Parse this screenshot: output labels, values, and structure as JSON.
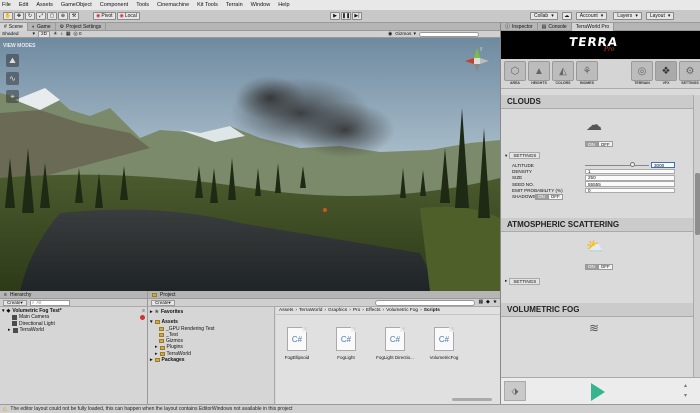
{
  "menu": [
    "File",
    "Edit",
    "Assets",
    "GameObject",
    "Component",
    "Tools",
    "Cinemachine",
    "Kit Tools",
    "Terrain",
    "Window",
    "Help"
  ],
  "toolbar": {
    "pivot": "Pivot",
    "local": "Local",
    "collab": "Collab",
    "account": "Account",
    "layers": "Layers",
    "layout": "Layout"
  },
  "scene_tabs": [
    "Scene",
    "Game",
    "Project Settings"
  ],
  "scene_bar": {
    "shaded": "Shaded",
    "mode_2d": "2D",
    "gizmos": "Gizmos"
  },
  "viewport": {
    "view_modes": "VIEW MODES",
    "gizmo_axis": "y"
  },
  "hierarchy": {
    "tab": "Hierarchy",
    "create": "Create",
    "search": "All",
    "items": [
      {
        "label": "Volumetric Fog Test*",
        "level": 0,
        "bold": true
      },
      {
        "label": "Main Camera",
        "level": 1
      },
      {
        "label": "Directional Light",
        "level": 1
      },
      {
        "label": "TerraWorld",
        "level": 1
      }
    ]
  },
  "project": {
    "tab": "Project",
    "create": "Create",
    "favorites": "Favorites",
    "tree": [
      {
        "label": "Assets",
        "level": 0,
        "bold": true
      },
      {
        "label": "_GPU Rendering Test",
        "level": 1
      },
      {
        "label": "_Test",
        "level": 1
      },
      {
        "label": "Gizmos",
        "level": 1
      },
      {
        "label": "Plugins",
        "level": 1
      },
      {
        "label": "TerraWorld",
        "level": 1
      },
      {
        "label": "Packages",
        "level": 0,
        "bold": true
      }
    ],
    "breadcrumb": [
      "Assets",
      "TerraWorld",
      "Graphics",
      "Pro",
      "Effects",
      "Volumetric Fog",
      "Scripts"
    ],
    "files": [
      {
        "name": "FogEllipsoid",
        "glyph": "C#"
      },
      {
        "name": "FogLight",
        "glyph": "C#"
      },
      {
        "name": "FogLight Directio...",
        "glyph": "C#"
      },
      {
        "name": "VolumetricFog",
        "glyph": "C#"
      }
    ]
  },
  "inspector": {
    "tabs": [
      "Inspector",
      "Console",
      "TerraWorld Pro"
    ],
    "logo_main": "TERRA",
    "logo_sub": "Pro",
    "icons_left": [
      {
        "icon": "area-icon",
        "label": "AREA"
      },
      {
        "icon": "heights-icon",
        "label": "HEIGHTS"
      },
      {
        "icon": "colors-icon",
        "label": "COLORS"
      },
      {
        "icon": "biomes-icon",
        "label": "BIOMES"
      }
    ],
    "icons_right": [
      {
        "icon": "terrain-icon",
        "label": "TERRAIN"
      },
      {
        "icon": "vfx-icon",
        "label": "VFX",
        "selected": true
      },
      {
        "icon": "settings-icon",
        "label": "SETTINGS"
      }
    ],
    "clouds": {
      "title": "CLOUDS",
      "on": "ON",
      "off": "OFF",
      "settings": "SETTINGS",
      "rows": [
        {
          "key": "ALTITUDE",
          "value": "3000",
          "slider": 0.76
        },
        {
          "key": "DENSITY",
          "value": "1"
        },
        {
          "key": "SIZE",
          "value": "250"
        },
        {
          "key": "SEED NO.",
          "value": "55555"
        },
        {
          "key": "EMIT PROBABILITY (%)",
          "value": "0"
        }
      ],
      "shadows_label": "SHADOWS",
      "shadows_on": "ON",
      "shadows_off": "OFF"
    },
    "atmospheric": {
      "title": "ATMOSPHERIC SCATTERING",
      "on": "ON",
      "off": "OFF",
      "settings": "SETTINGS"
    },
    "fog": {
      "title": "VOLUMETRIC FOG"
    }
  },
  "status": "The editor layout could not be fully loaded, this can happen when the layout contains EditorWindows not available in this project",
  "colors": {
    "accent_green": "#35b58e",
    "selection_blue": "#3d6fb3"
  }
}
